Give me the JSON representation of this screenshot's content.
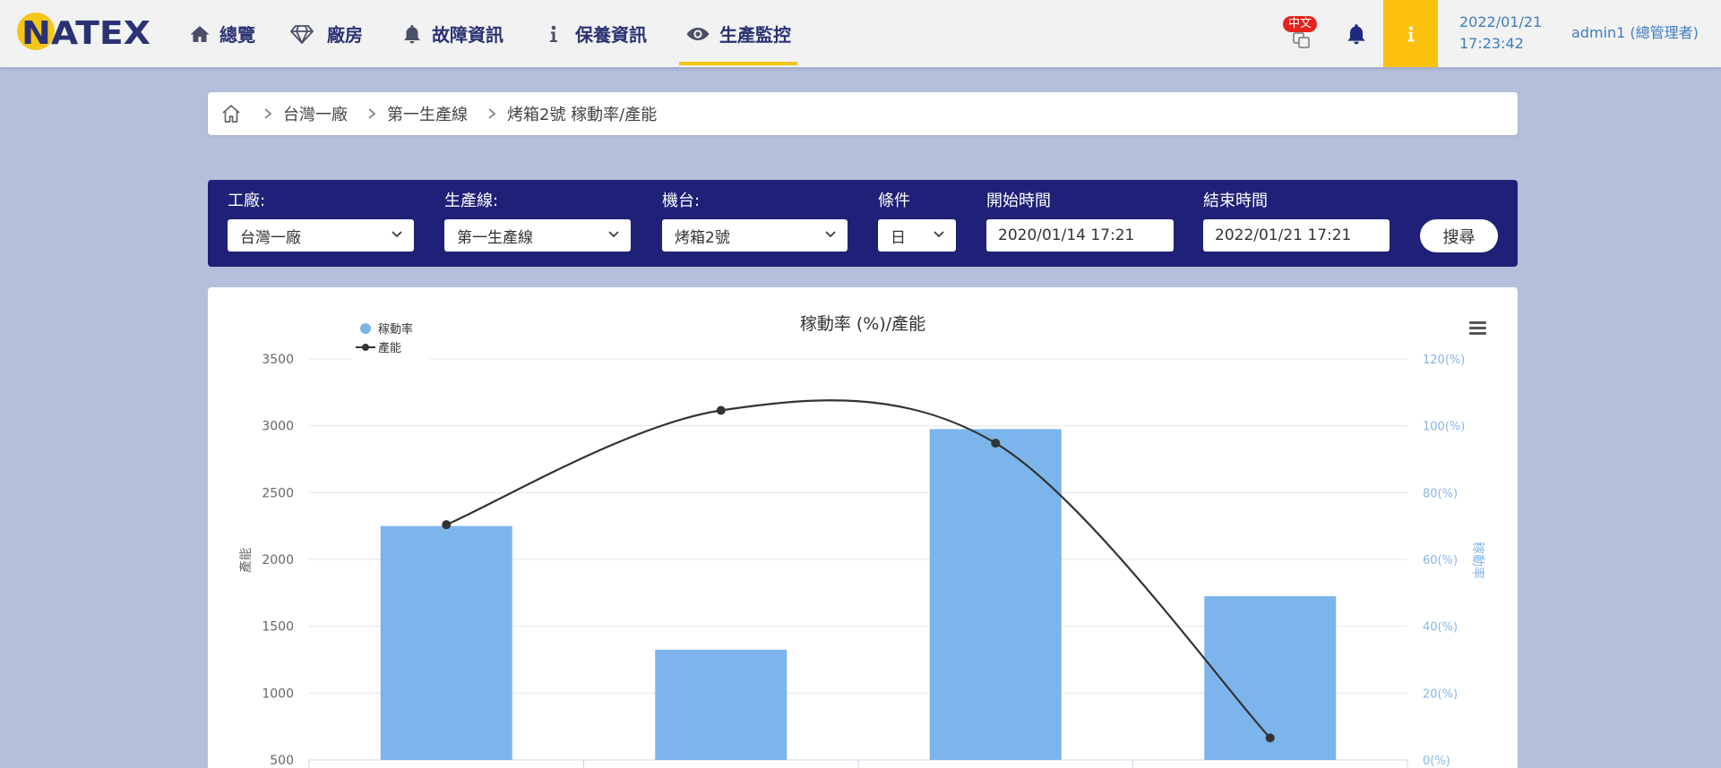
{
  "brand": {
    "logo_text": "NATEX"
  },
  "colors": {
    "page_bg": "#b4bfdb",
    "nav_text": "#2b3273",
    "accent": "#f5c518",
    "filter_bar": "#1e2177",
    "link_blue": "#3e7cc0",
    "badge": "#e8231e"
  },
  "nav": {
    "items": [
      {
        "label": "總覽",
        "icon": "home-icon"
      },
      {
        "label": "廠房",
        "icon": "diamond-icon"
      },
      {
        "label": "故障資訊",
        "icon": "bell-icon"
      },
      {
        "label": "保養資訊",
        "icon": "info-icon"
      },
      {
        "label": "生產監控",
        "icon": "eye-icon",
        "active": true
      }
    ]
  },
  "header": {
    "language": "中文",
    "language_icon": "language-icon",
    "notifications_icon": "bell-icon",
    "info_icon": "info-icon",
    "date": "2022/01/21",
    "time": "17:23:42",
    "user": "admin1 (總管理者)"
  },
  "breadcrumb": {
    "home_icon": "home-icon",
    "items": [
      "台灣一廠",
      "第一生產線",
      "烤箱2號 稼動率/產能"
    ]
  },
  "filters": {
    "factory_label": "工廠:",
    "factory_value": "台灣一廠",
    "line_label": "生產線:",
    "line_value": "第一生產線",
    "machine_label": "機台:",
    "machine_value": "烤箱2號",
    "condition_label": "條件",
    "condition_value": "日",
    "start_label": "開始時間",
    "start_value": "2020/01/14 17:21",
    "end_label": "結束時間",
    "end_value": "2022/01/21 17:21",
    "search_label": "搜尋"
  },
  "chart_data": {
    "type": "bar",
    "title": "稼動率 (%)/產能",
    "series": [
      {
        "name": "稼動率",
        "type": "bar",
        "y_axis": "right",
        "color": "#7cb5ec",
        "values": [
          70,
          33,
          99,
          49
        ]
      },
      {
        "name": "產能",
        "type": "line",
        "y_axis": "left",
        "color": "#333333",
        "values": [
          2260,
          3115,
          2870,
          665
        ]
      }
    ],
    "ylabel": "產能",
    "y2label": "稼動率",
    "ylim": [
      500,
      3500
    ],
    "y2lim": [
      0,
      120
    ],
    "y_ticks": [
      500,
      1000,
      1500,
      2000,
      2500,
      3000,
      3500
    ],
    "y2_ticks": [
      0,
      20,
      40,
      60,
      80,
      100,
      120
    ],
    "y2_tick_labels": [
      "0(%)",
      "20(%)",
      "40(%)",
      "60(%)",
      "80(%)",
      "100(%)",
      "120(%)"
    ],
    "grid": true,
    "legend": "top-left"
  }
}
